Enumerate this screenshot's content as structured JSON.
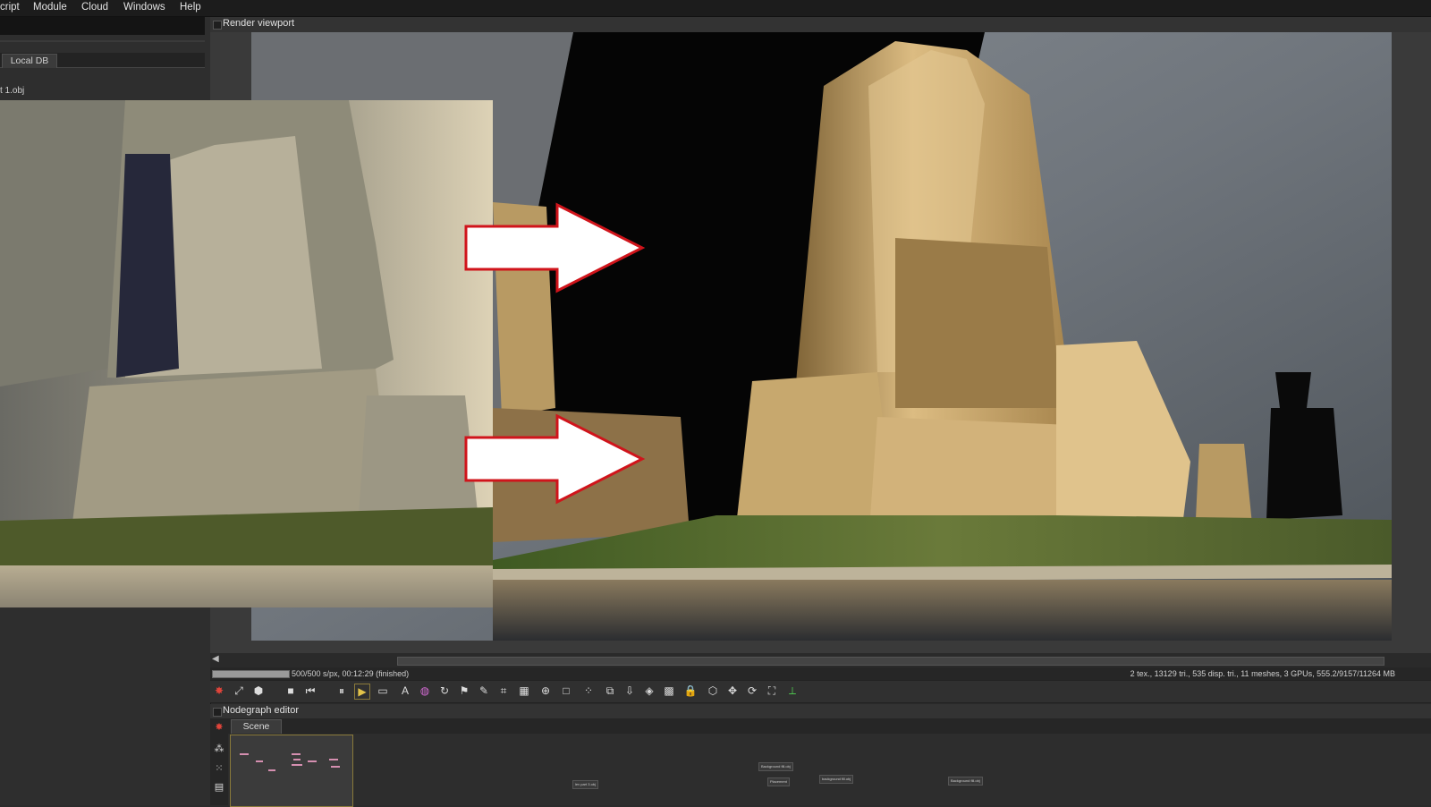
{
  "menubar": {
    "items": [
      "cript",
      "Module",
      "Cloud",
      "Windows",
      "Help"
    ]
  },
  "left_panel": {
    "tab_label": "Local DB",
    "file_label": "t 1.obj"
  },
  "viewport": {
    "title": "Render viewport"
  },
  "status": {
    "progress_text": "500/500 s/px, 00:12:29 (finished)",
    "progress_fraction": 1.0,
    "scene_stats": "2 tex., 13129 tri., 535 disp. tri., 11 meshes, 3 GPUs, 555.2/9157/11264 MB"
  },
  "toolbar": {
    "buttons": [
      "octane-logo-icon",
      "camera-reset-icon",
      "color-cube-icon",
      "stop-icon",
      "rewind-icon",
      "pause-icon",
      "play-icon",
      "monitor-icon",
      "afi-icon",
      "color-wheel-icon",
      "refresh-icon",
      "flag-icon",
      "picker-icon",
      "region-icon",
      "layers-icon",
      "zoom-icon",
      "frame-icon",
      "film-icon",
      "copy-icon",
      "export-icon",
      "object-icon",
      "texture-icon",
      "lock-icon",
      "cube-icon",
      "move-icon",
      "rotate-icon",
      "fit-icon",
      "axis-icon"
    ]
  },
  "nodegraph": {
    "title": "Nodegraph editor",
    "tab_label": "Scene",
    "nodes": [
      "Background fill.obj",
      "Placement",
      "background fill.obj",
      "Background fill.obj",
      "lev part 3.obj"
    ]
  },
  "colors": {
    "accent_gold": "#c9a75c",
    "arrow_outline": "#d0141b",
    "panel_dark": "#2b2b2b"
  }
}
